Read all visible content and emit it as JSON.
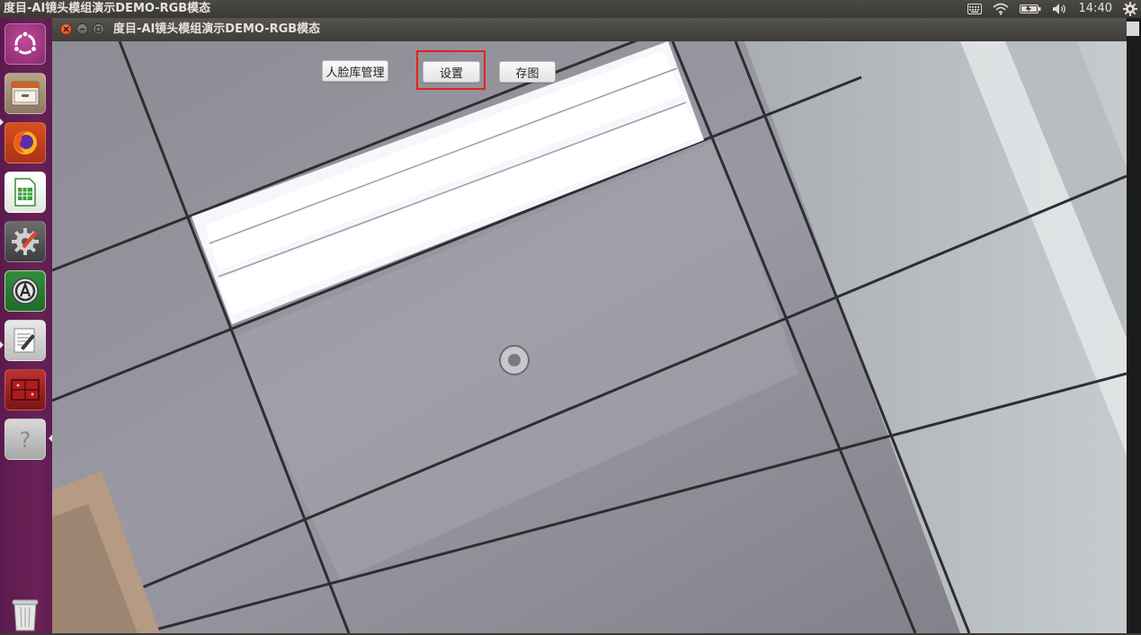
{
  "top_panel": {
    "app_title": "度目-AI镜头模组演示DEMO-RGB模态",
    "clock": "14:40"
  },
  "launcher": {
    "items": [
      {
        "name": "ubuntu-dash"
      },
      {
        "name": "files"
      },
      {
        "name": "firefox"
      },
      {
        "name": "spreadsheet"
      },
      {
        "name": "system-settings"
      },
      {
        "name": "software-updater"
      },
      {
        "name": "text-editor"
      },
      {
        "name": "demo-app"
      },
      {
        "name": "help"
      },
      {
        "name": "trash"
      }
    ]
  },
  "window": {
    "title": "度目-AI镜头模组演示DEMO-RGB模态"
  },
  "toolbar": {
    "face_db_label": "人脸库管理",
    "settings_label": "设置",
    "save_image_label": "存图"
  },
  "colors": {
    "launcher_bg": "#6a2257",
    "panel_bg": "#3c3b37",
    "highlight": "#e3231a",
    "close_button": "#e05a2b"
  }
}
